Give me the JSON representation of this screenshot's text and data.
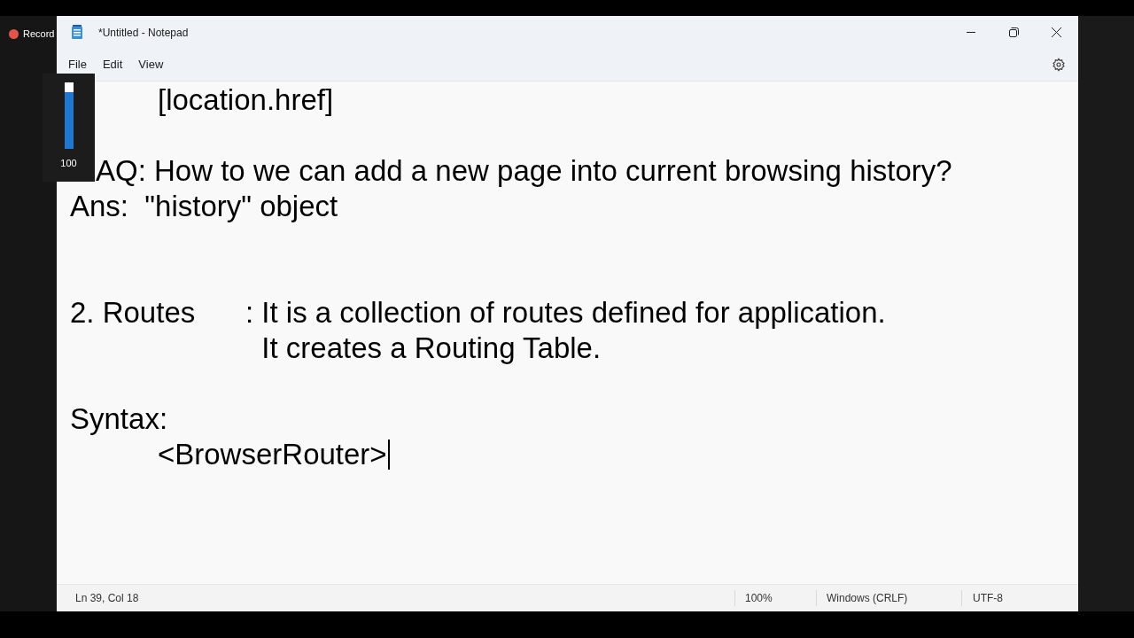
{
  "recorder": {
    "label": "Record"
  },
  "window": {
    "title": "*Untitled - Notepad"
  },
  "menu": [
    "File",
    "Edit",
    "View"
  ],
  "editor": {
    "lines": [
      {
        "kind": "text",
        "text": "\t[location.href]"
      },
      {
        "kind": "blank"
      },
      {
        "kind": "covered",
        "text": "AQ: How to we can add a new page into current browsing history?"
      },
      {
        "kind": "text",
        "text": "Ans:  \"history\" object"
      },
      {
        "kind": "blank"
      },
      {
        "kind": "blank"
      },
      {
        "kind": "text",
        "text": "2. Routes\t: It is a collection of routes defined for application."
      },
      {
        "kind": "text",
        "text": "\t\t  It creates a Routing Table."
      },
      {
        "kind": "blank"
      },
      {
        "kind": "text",
        "text": "Syntax:"
      },
      {
        "kind": "cursor",
        "text": "\t<BrowserRouter>"
      }
    ]
  },
  "status_bar": {
    "position": "Ln 39, Col 18",
    "zoom": "100%",
    "line_endings": "Windows (CRLF)",
    "encoding": "UTF-8"
  },
  "volume": {
    "level": 1,
    "reading": "100"
  }
}
